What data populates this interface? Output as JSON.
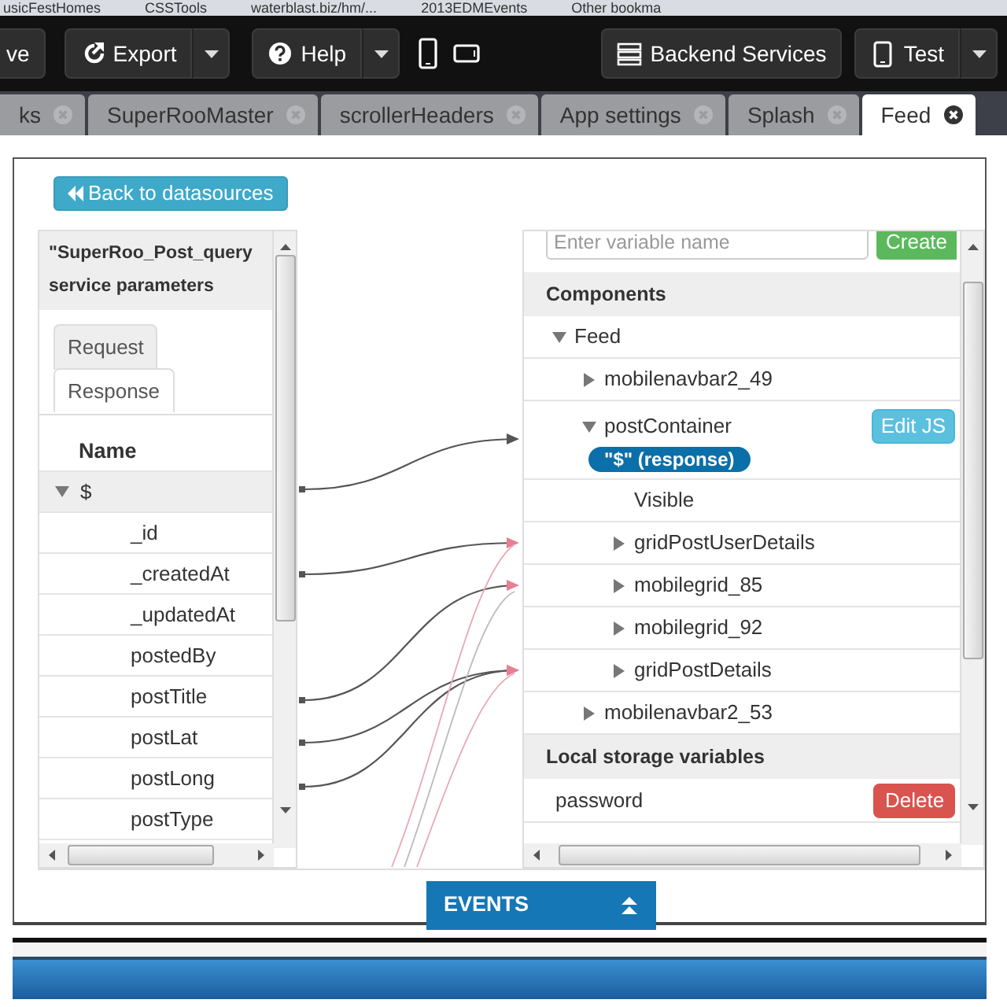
{
  "bookmarks": [
    "usicFestHomes",
    "CSSTools",
    "waterblast.biz/hm/...",
    "2013EDMEvents",
    "Other bookma"
  ],
  "toolbar": {
    "left": [
      {
        "label": "ve",
        "kind": "plain"
      },
      {
        "label": "Export",
        "kind": "split"
      },
      {
        "label": "Help",
        "kind": "split"
      }
    ],
    "right": [
      {
        "label": "Backend Services",
        "kind": "plain"
      },
      {
        "label": "Test",
        "kind": "split"
      }
    ]
  },
  "tabs": [
    {
      "label": "ks",
      "selected": false
    },
    {
      "label": "SuperRooMaster",
      "selected": false
    },
    {
      "label": "scrollerHeaders",
      "selected": false
    },
    {
      "label": "App settings",
      "selected": false
    },
    {
      "label": "Splash",
      "selected": false
    },
    {
      "label": "Feed",
      "selected": true
    }
  ],
  "back_button": "Back to datasources",
  "service": {
    "title": "\"SuperRoo_Post_query service parameters",
    "tabs": [
      {
        "label": "Request",
        "selected": false
      },
      {
        "label": "Response",
        "selected": true
      }
    ],
    "column": "Name",
    "tree": [
      {
        "label": "$",
        "expanded": true,
        "children": [
          {
            "label": "_id"
          },
          {
            "label": "_createdAt"
          },
          {
            "label": "_updatedAt"
          },
          {
            "label": "postedBy"
          },
          {
            "label": "postTitle"
          },
          {
            "label": "postLat"
          },
          {
            "label": "postLong"
          },
          {
            "label": "postType"
          }
        ]
      }
    ]
  },
  "variable": {
    "placeholder": "Enter variable name",
    "button": "Create"
  },
  "components": {
    "title": "Components",
    "tree": [
      {
        "label": "Feed",
        "kind": "node",
        "expanded": true,
        "children": [
          {
            "label": "mobilenavbar2_49",
            "kind": "node",
            "expanded": false
          },
          {
            "label": "postContainer",
            "kind": "node",
            "expanded": true,
            "button": "Edit JS",
            "binding": "\"$\" (response)",
            "children": [
              {
                "label": "Visible",
                "kind": "property"
              },
              {
                "label": "gridPostUserDetails",
                "kind": "node",
                "expanded": false
              },
              {
                "label": "mobilegrid_85",
                "kind": "node",
                "expanded": false
              },
              {
                "label": "mobilegrid_92",
                "kind": "node",
                "expanded": false
              },
              {
                "label": "gridPostDetails",
                "kind": "node",
                "expanded": false
              }
            ]
          },
          {
            "label": "mobilenavbar2_53",
            "kind": "node",
            "expanded": false
          }
        ]
      }
    ]
  },
  "local_storage": {
    "title": "Local storage variables",
    "items": [
      {
        "name": "password",
        "button": "Delete"
      }
    ]
  },
  "events_bar": "EVENTS"
}
